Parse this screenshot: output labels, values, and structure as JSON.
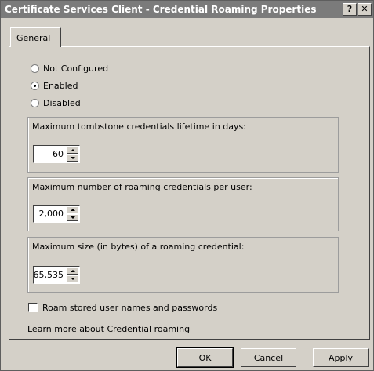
{
  "window": {
    "title": "Certificate Services Client - Credential Roaming Properties",
    "help": "?",
    "close": "✕"
  },
  "tabs": [
    {
      "label": "General",
      "selected": true
    }
  ],
  "radios": [
    {
      "label": "Not Configured",
      "checked": false
    },
    {
      "label": "Enabled",
      "checked": true
    },
    {
      "label": "Disabled",
      "checked": false
    }
  ],
  "groups": [
    {
      "label": "Maximum tombstone credentials lifetime in days:",
      "value": "60"
    },
    {
      "label": "Maximum number of roaming credentials per user:",
      "value": "2,000"
    },
    {
      "label": "Maximum size (in bytes) of a roaming credential:",
      "value": "65,535"
    }
  ],
  "checkbox": {
    "label": "Roam stored user names and passwords",
    "checked": false
  },
  "learn_more": {
    "prefix": "Learn more about ",
    "link": "Credential roaming"
  },
  "buttons": {
    "ok": "OK",
    "cancel": "Cancel",
    "apply": "Apply"
  }
}
